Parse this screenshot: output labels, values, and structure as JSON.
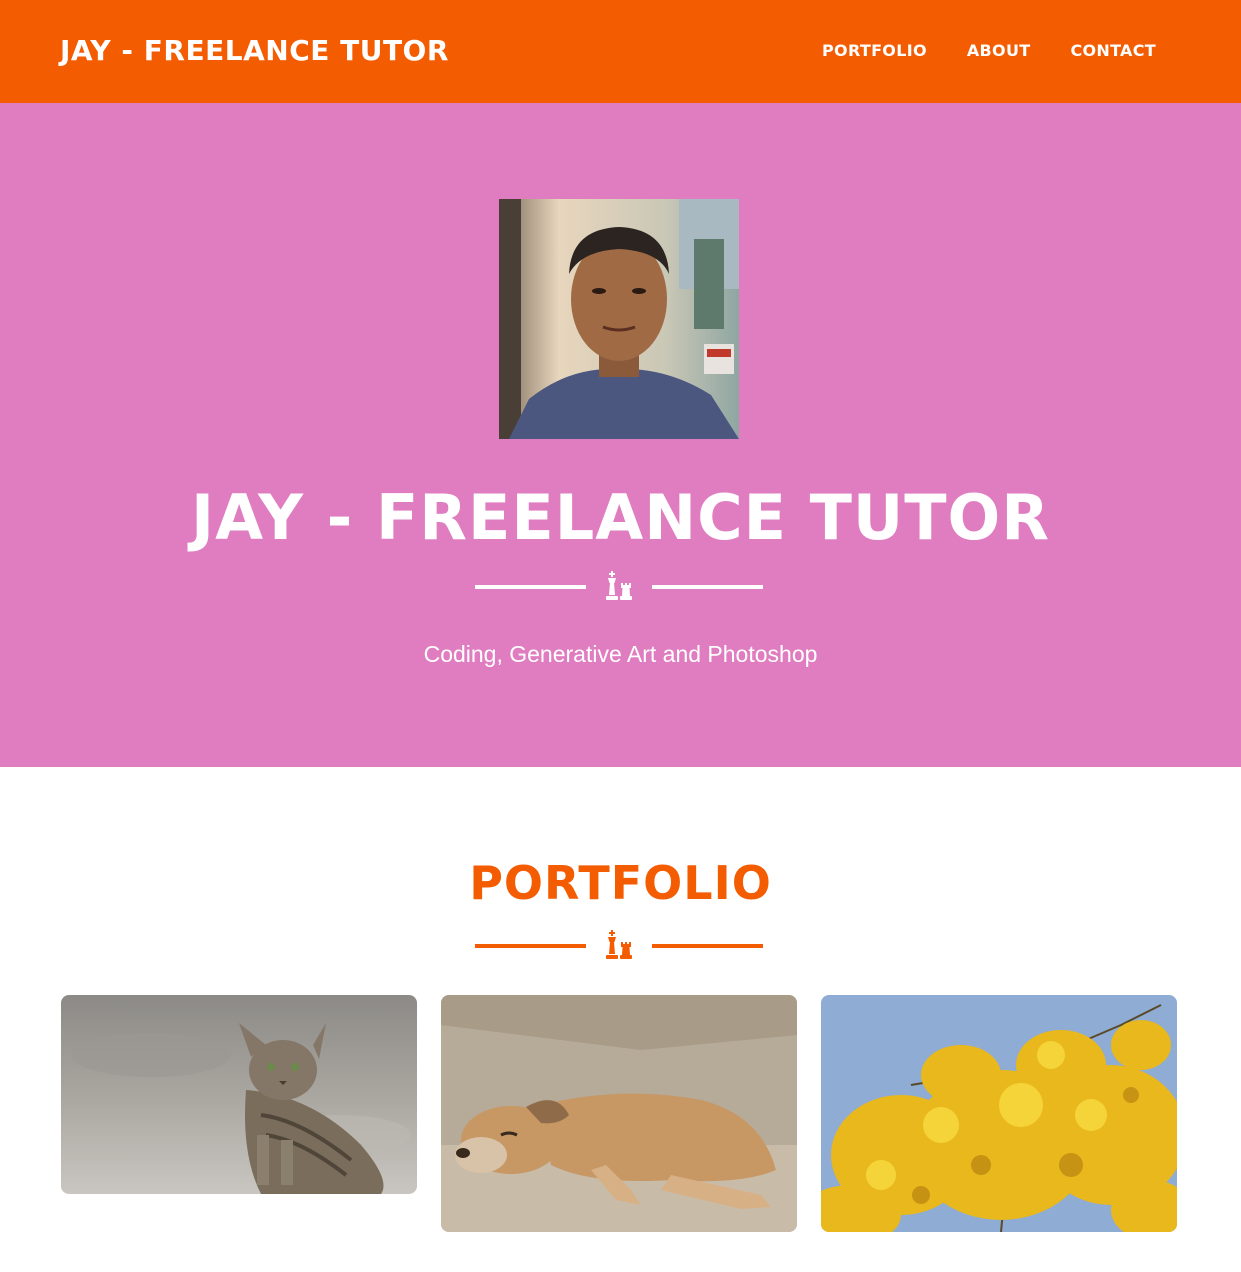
{
  "navbar": {
    "brand": "JAY - FREELANCE TUTOR",
    "links": [
      "PORTFOLIO",
      "ABOUT",
      "CONTACT"
    ]
  },
  "hero": {
    "title": "JAY - FREELANCE TUTOR",
    "subtitle": "Coding, Generative Art and Photoshop",
    "divider_icon": "chess-pieces-icon"
  },
  "portfolio": {
    "title": "PORTFOLIO",
    "divider_icon": "chess-pieces-icon",
    "items": [
      {
        "image": "cat-photo"
      },
      {
        "image": "dog-photo"
      },
      {
        "image": "yellow-flowers-photo"
      }
    ]
  },
  "colors": {
    "primary": "#f45c02",
    "hero_bg": "#e07dc0",
    "text_light": "#ffffff"
  }
}
